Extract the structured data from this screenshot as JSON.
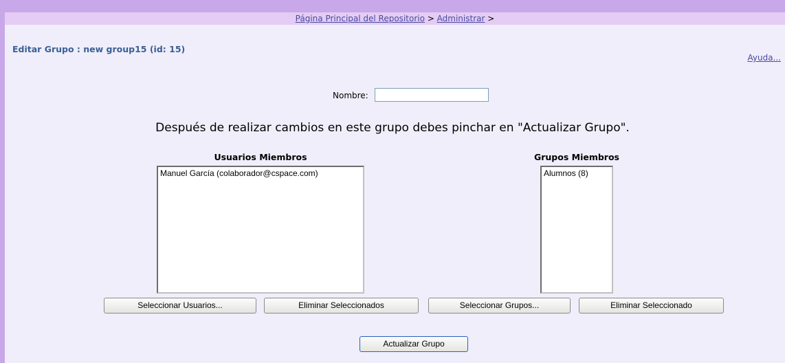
{
  "breadcrumb": {
    "home_link": "Página Principal del Repositorio",
    "sep1": ">",
    "admin_link": "Administrar",
    "sep2": ">"
  },
  "page_title": "Editar Grupo : new group15 (id: 15)",
  "help_link": "Ayuda...",
  "name_field": {
    "label": "Nombre:",
    "value": ""
  },
  "instruction": "Después de realizar cambios en este grupo debes pinchar en \"Actualizar Grupo\".",
  "users": {
    "title": "Usuarios Miembros",
    "items": [
      "Manuel García (colaborador@cspace.com)"
    ],
    "select_button": "Seleccionar Usuarios...",
    "remove_button": "Eliminar Seleccionados"
  },
  "groups": {
    "title": "Grupos Miembros",
    "items": [
      "Alumnos (8)"
    ],
    "select_button": "Seleccionar Grupos...",
    "remove_button": "Eliminar Seleccionado"
  },
  "update_button": "Actualizar Grupo"
}
